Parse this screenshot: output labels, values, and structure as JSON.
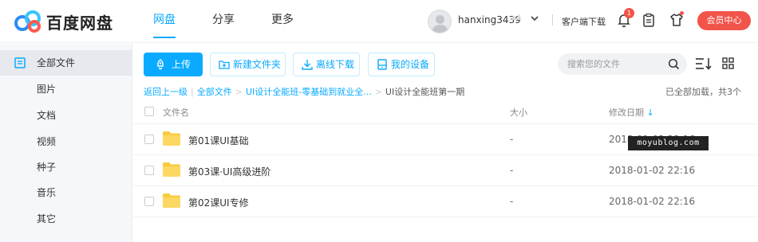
{
  "brand": {
    "name": "百度网盘",
    "accent": "#09aaff",
    "red": "#f25449"
  },
  "nav": [
    {
      "label": "网盘",
      "active": true
    },
    {
      "label": "分享",
      "active": false
    },
    {
      "label": "更多",
      "active": false
    }
  ],
  "user": {
    "name": "hanxing3439",
    "client_download": "客户端下载",
    "notifications": "1",
    "member_center": "会员中心"
  },
  "sidebar": {
    "items": [
      {
        "label": "全部文件",
        "icon": "folder-list-icon",
        "active": true
      },
      {
        "label": "图片"
      },
      {
        "label": "文档"
      },
      {
        "label": "视频"
      },
      {
        "label": "种子"
      },
      {
        "label": "音乐"
      },
      {
        "label": "其它"
      }
    ]
  },
  "toolbar": {
    "upload": "上传",
    "new_folder": "新建文件夹",
    "offline_download": "离线下载",
    "my_devices": "我的设备"
  },
  "search": {
    "placeholder": "搜索您的文件"
  },
  "breadcrumb": {
    "back": "返回上一级",
    "all_files": "全部文件",
    "parent": "UI设计全能班-零基础到就业全...",
    "current": "UI设计全能班第一期"
  },
  "load_status": "已全部加载，共3个",
  "table": {
    "headers": {
      "name": "文件名",
      "size": "大小",
      "modified": "修改日期"
    },
    "rows": [
      {
        "name": "第01课UI基础",
        "size": "-",
        "modified": "2018-01-02 22:16"
      },
      {
        "name": "第03课·UI高级进阶",
        "size": "-",
        "modified": "2018-01-02 22:16"
      },
      {
        "name": "第02课UI专修",
        "size": "-",
        "modified": "2018-01-02 22:16"
      }
    ]
  },
  "watermark": "moyublog.com"
}
